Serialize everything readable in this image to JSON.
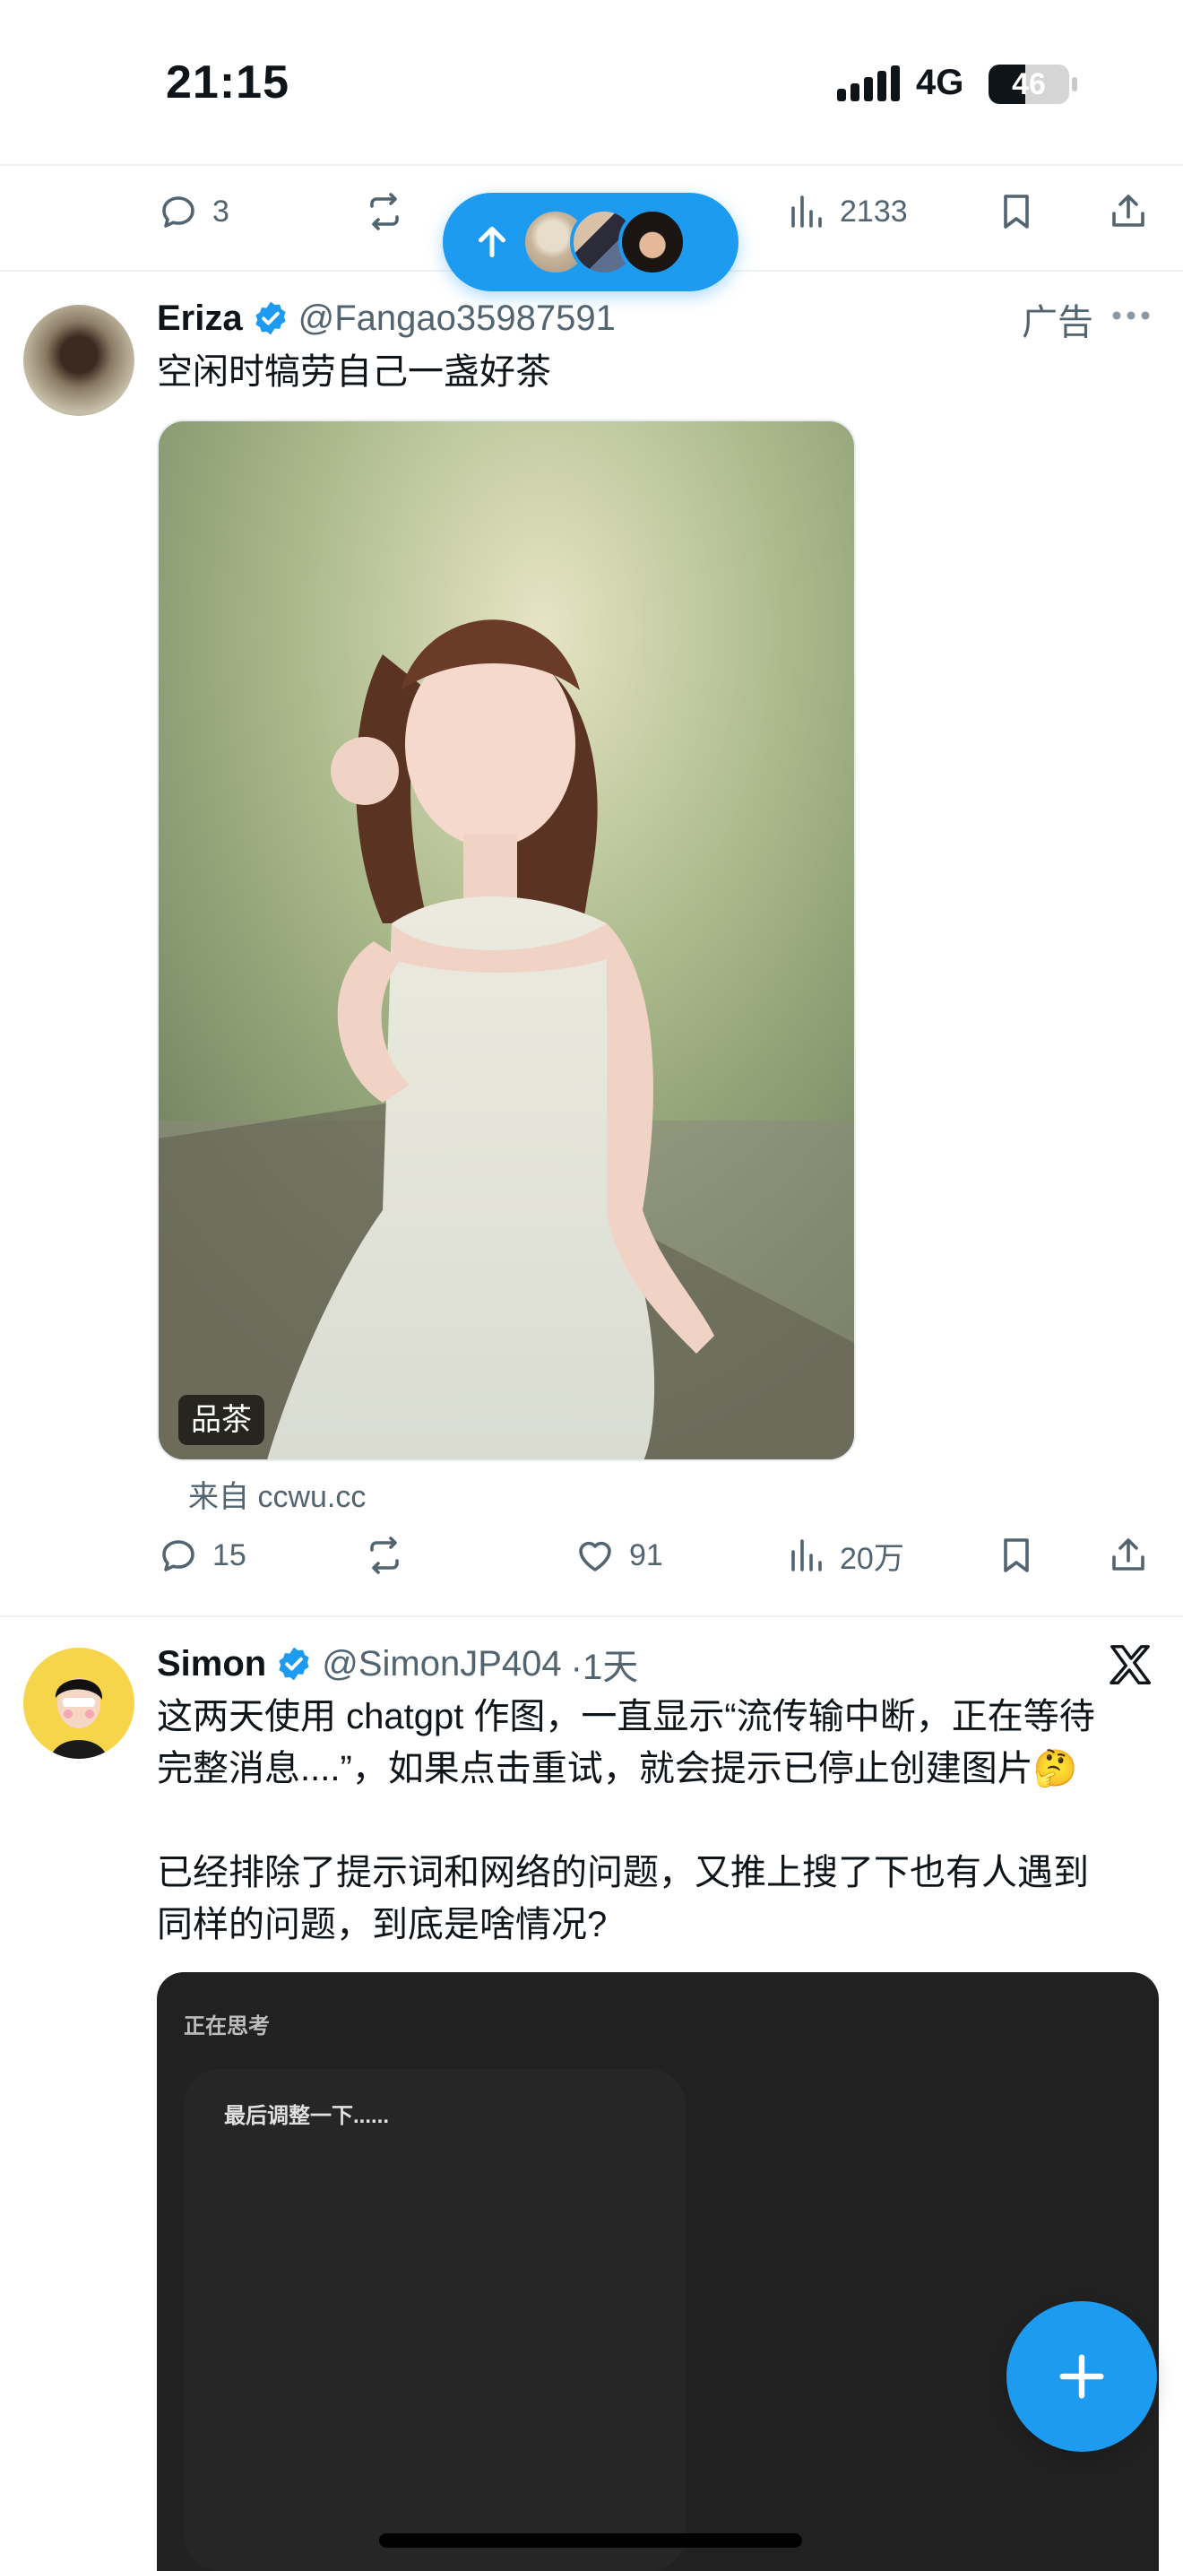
{
  "status_bar": {
    "time": "21:15",
    "network": "4G",
    "battery_level": "46",
    "battery_fraction": 0.46
  },
  "prev_post_actions": {
    "replies": "3",
    "views": "2133"
  },
  "new_posts_pill": {
    "icon": "arrow-up-icon"
  },
  "post1": {
    "display_name": "Eriza",
    "handle": "@Fangao35987591",
    "ad_label": "广告",
    "text": "空闲时犒劳自己一盏好茶",
    "image_badge": "品茶",
    "source": "来自 ccwu.cc",
    "replies": "15",
    "likes": "91",
    "views": "20万"
  },
  "post2": {
    "display_name": "Simon",
    "handle": "@SimonJP404",
    "time": "·1天",
    "text_lines": [
      "这两天使用 chatgpt 作图，一直显示“流传输中断，正在等待",
      "完整消息....”，如果点击重试，就会提示已停止创建图片🤔",
      "",
      "已经排除了提示词和网络的问题，又推上搜了下也有人遇到",
      "同样的问题，到底是啥情况?"
    ],
    "screenshot": {
      "title": "正在思考",
      "message": "最后调整一下......"
    }
  },
  "colors": {
    "accent": "#1d9bf0",
    "secondary_text": "#536471",
    "divider": "#eff3f4"
  }
}
